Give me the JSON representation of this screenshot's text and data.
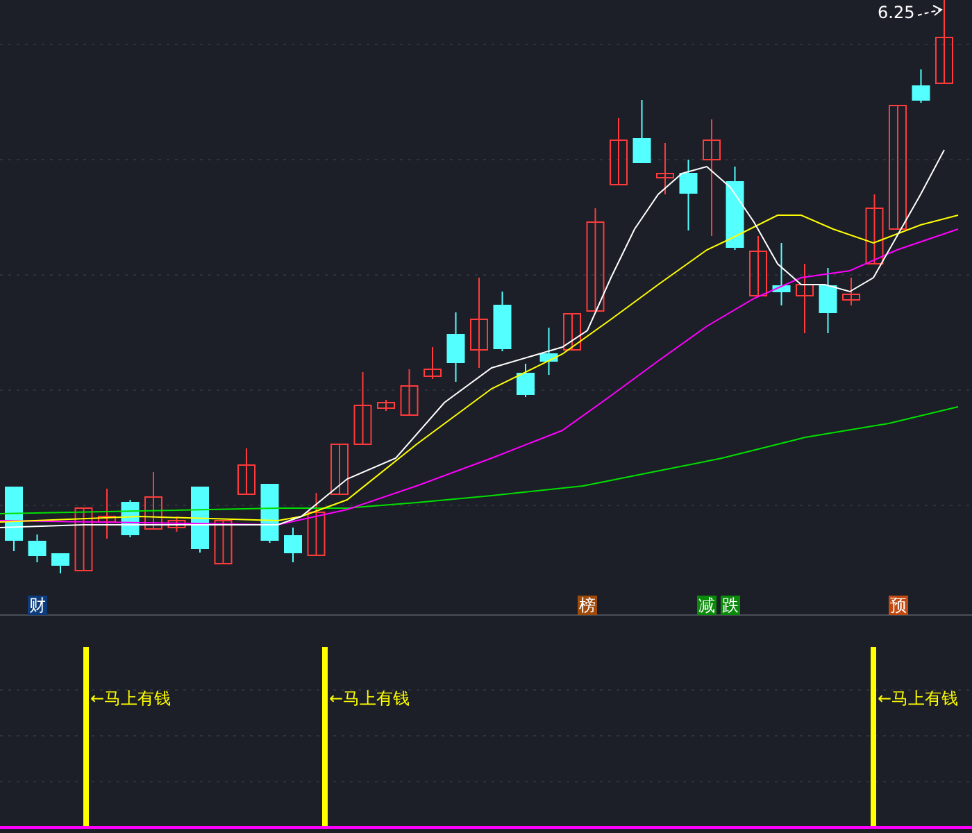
{
  "chart": {
    "price_label": "6.25"
  },
  "tags": [
    {
      "text": "财",
      "color": "#0c3c7c"
    },
    {
      "text": "榜",
      "color": "#a04a0a"
    },
    {
      "text": "减",
      "color": "#0a8a0a"
    },
    {
      "text": "跌",
      "color": "#0a8a0a"
    },
    {
      "text": "预",
      "color": "#c04a10"
    }
  ],
  "signals": [
    {
      "label": "←马上有钱"
    },
    {
      "label": "←马上有钱"
    },
    {
      "label": "←马上有钱"
    }
  ]
}
